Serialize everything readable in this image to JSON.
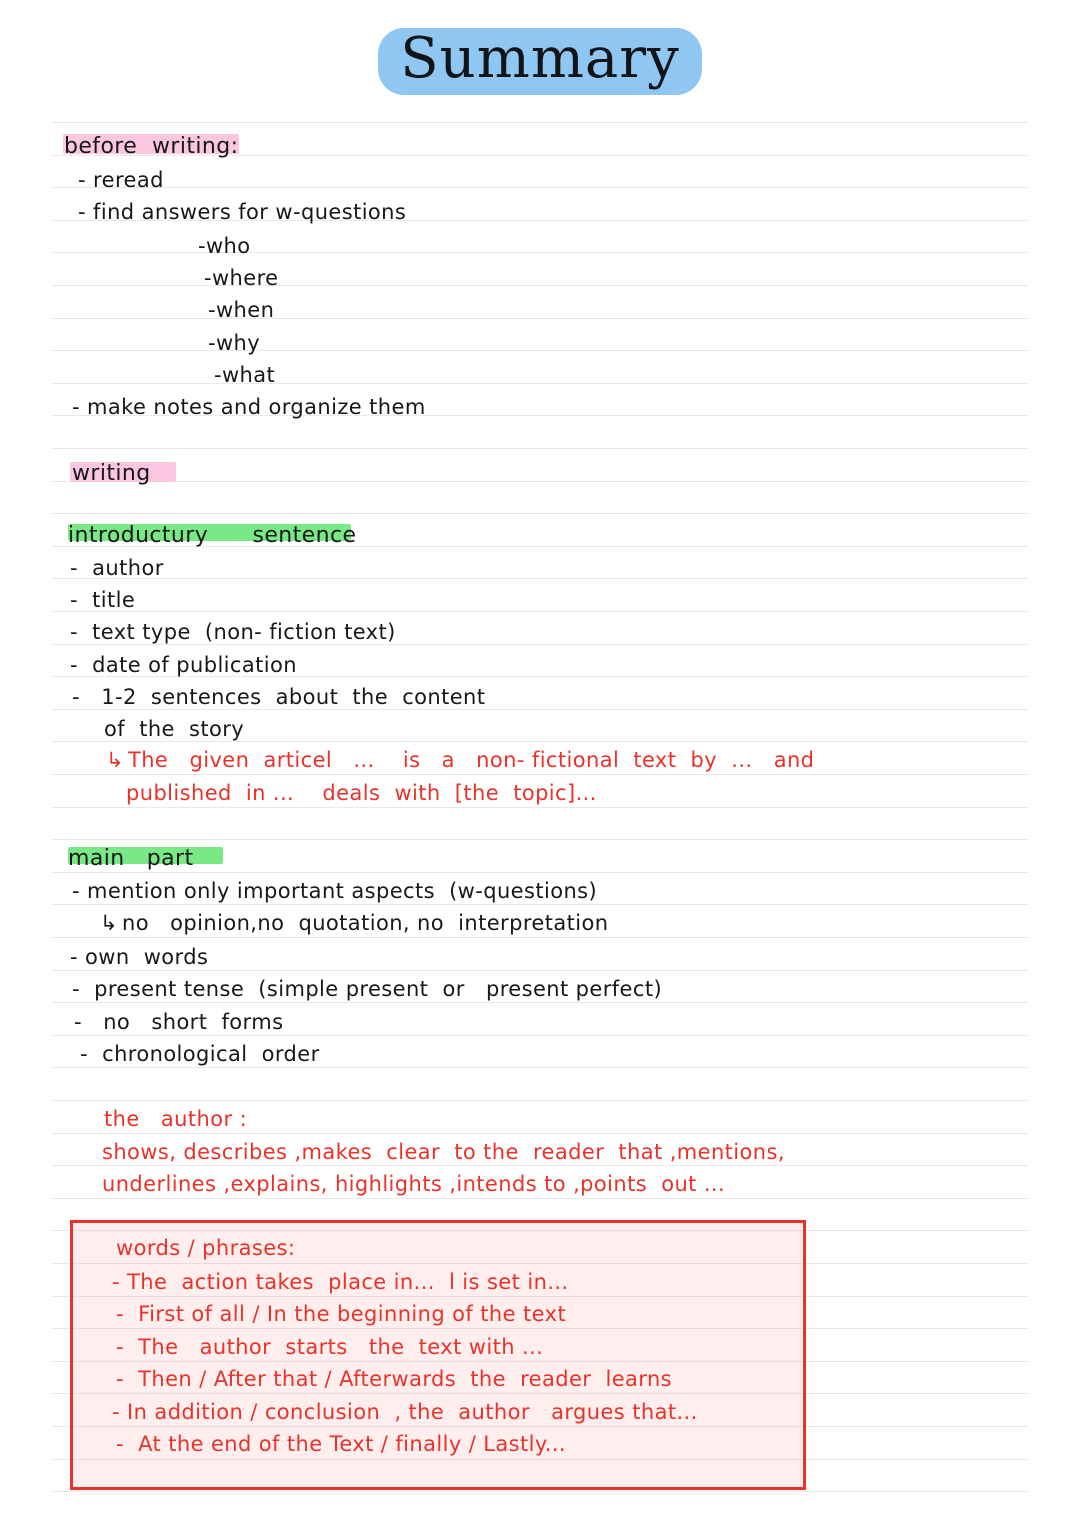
{
  "page": {
    "title": "Summary",
    "title_highlight_color": "#8fc7f2",
    "paper_line_color": "#e9e9e9",
    "ink_color": "#16181c",
    "red_ink_color": "#e8322a",
    "pink_highlight_color": "#fbc6e0",
    "green_highlight_color": "#79e985"
  },
  "sections": {
    "before_writing": {
      "heading": "before  writing:",
      "heading_highlight": "pink",
      "items": [
        "- reread",
        "- find answers for w-questions"
      ],
      "w_questions": [
        "-who",
        "-where",
        "-when",
        "-why",
        "-what"
      ],
      "closing_item": "- make notes and organize them"
    },
    "writing": {
      "heading": "writing",
      "heading_highlight": "pink"
    },
    "introductory_sentence": {
      "heading": "introductury      sentence",
      "heading_highlight": "green",
      "items": [
        "-  author",
        "-  title",
        "-  text type  (non- fiction text)",
        "-  date of publication",
        "-   1-2  sentences  about  the  content",
        "of  the  story"
      ],
      "example_arrow": "↳",
      "example_line_1": "The   given  articel   ...    is   a   non- fictional  text  by  ...   and",
      "example_line_2": "published  in ...    deals  with  [the  topic]..."
    },
    "main_part": {
      "heading": "main   part",
      "heading_highlight": "green",
      "items": [
        "- mention only important aspects  (w-questions)",
        "- own  words",
        "-  present tense  (simple present  or   present perfect)",
        "-   no   short  forms",
        "-  chronological  order"
      ],
      "sub_arrow": "↳",
      "sub_item": "no   opinion,no  quotation, no  interpretation"
    },
    "the_author": {
      "heading": "the   author :",
      "line_1": "shows, describes ,makes  clear  to the  reader  that ,mentions,",
      "line_2": "underlines ,explains, highlights ,intends to ,points  out ..."
    },
    "words_phrases": {
      "heading": "words / phrases:",
      "items": [
        "- The  action takes  place in...  l is set in...",
        "-  First of all / In the beginning of the text",
        "-  The   author  starts   the  text with ...",
        "-  Then / After that / Afterwards  the  reader  learns",
        "- In addition / conclusion  , the  author   argues that...",
        "-  At the end of the Text / finally / Lastly..."
      ]
    }
  }
}
